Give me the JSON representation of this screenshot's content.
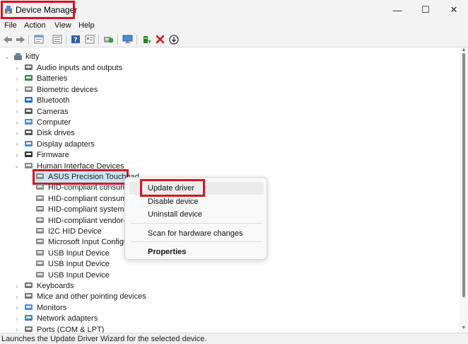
{
  "window": {
    "title": "Device Manager",
    "controls": {
      "minimize": "—",
      "maximize": "☐",
      "close": "✕"
    }
  },
  "menubar": {
    "items": [
      "File",
      "Action",
      "View",
      "Help"
    ]
  },
  "toolbar": {
    "icons": [
      "back-arrow-icon",
      "forward-arrow-icon",
      "properties-sheet-icon",
      "list-view-icon",
      "help-icon",
      "driver-details-icon",
      "scan-hardware-icon",
      "monitor-icon",
      "update-driver-icon",
      "uninstall-icon",
      "download-icon"
    ]
  },
  "tree": {
    "root": "kitty",
    "categories": [
      {
        "label": "Audio inputs and outputs",
        "icon": "speaker-icon",
        "expanded": false
      },
      {
        "label": "Batteries",
        "icon": "battery-icon",
        "expanded": false
      },
      {
        "label": "Biometric devices",
        "icon": "fingerprint-icon",
        "expanded": false
      },
      {
        "label": "Bluetooth",
        "icon": "bluetooth-icon",
        "expanded": false
      },
      {
        "label": "Cameras",
        "icon": "camera-icon",
        "expanded": false
      },
      {
        "label": "Computer",
        "icon": "computer-icon",
        "expanded": false
      },
      {
        "label": "Disk drives",
        "icon": "disk-drive-icon",
        "expanded": false
      },
      {
        "label": "Display adapters",
        "icon": "display-adapter-icon",
        "expanded": false
      },
      {
        "label": "Firmware",
        "icon": "firmware-icon",
        "expanded": false
      },
      {
        "label": "Human Interface Devices",
        "icon": "hid-icon",
        "expanded": true
      },
      {
        "label": "Keyboards",
        "icon": "keyboard-icon",
        "expanded": false
      },
      {
        "label": "Mice and other pointing devices",
        "icon": "mouse-icon",
        "expanded": false
      },
      {
        "label": "Monitors",
        "icon": "monitor-icon",
        "expanded": false
      },
      {
        "label": "Network adapters",
        "icon": "network-adapter-icon",
        "expanded": false
      },
      {
        "label": "Ports (COM & LPT)",
        "icon": "port-icon",
        "expanded": false
      }
    ],
    "hid_children": [
      {
        "label": "ASUS Precision Touchpad",
        "selected": true
      },
      {
        "label": "HID-compliant consume",
        "selected": false
      },
      {
        "label": "HID-compliant consume",
        "selected": false
      },
      {
        "label": "HID-compliant system co",
        "selected": false
      },
      {
        "label": "HID-compliant vendor-d",
        "selected": false
      },
      {
        "label": "I2C HID Device",
        "selected": false
      },
      {
        "label": "Microsoft Input Configu",
        "selected": false
      },
      {
        "label": "USB Input Device",
        "selected": false
      },
      {
        "label": "USB Input Device",
        "selected": false
      },
      {
        "label": "USB Input Device",
        "selected": false
      }
    ]
  },
  "context_menu": {
    "items": [
      {
        "label": "Update driver",
        "bold": false,
        "highlighted": true
      },
      {
        "label": "Disable device",
        "bold": false,
        "highlighted": false
      },
      {
        "label": "Uninstall device",
        "bold": false,
        "highlighted": false
      },
      {
        "label": "Scan for hardware changes",
        "bold": false,
        "highlighted": false
      },
      {
        "label": "Properties",
        "bold": true,
        "highlighted": false
      }
    ]
  },
  "statusbar": {
    "text": "Launches the Update Driver Wizard for the selected device."
  },
  "colors": {
    "annotation_red": "#d8141d",
    "selection_blue": "#cce4f7",
    "chrome_gray": "#f3f3f3"
  }
}
